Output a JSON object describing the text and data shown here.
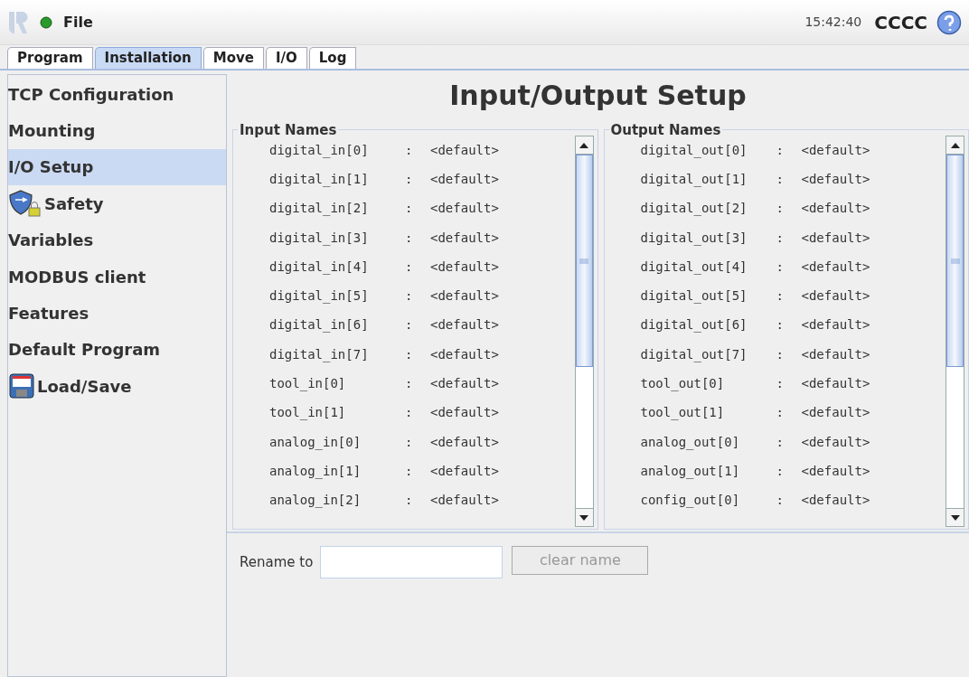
{
  "header": {
    "menu": "File",
    "time": "15:42:40",
    "robot_name": "CCCC"
  },
  "tabs": [
    {
      "label": "Program",
      "selected": false
    },
    {
      "label": "Installation",
      "selected": true
    },
    {
      "label": "Move",
      "selected": false
    },
    {
      "label": "I/O",
      "selected": false
    },
    {
      "label": "Log",
      "selected": false
    }
  ],
  "sidebar": {
    "items": [
      {
        "label": "TCP Configuration",
        "selected": false
      },
      {
        "label": "Mounting",
        "selected": false
      },
      {
        "label": "I/O Setup",
        "selected": true
      },
      {
        "label": "Safety",
        "selected": false,
        "kind": "safety"
      },
      {
        "label": "Variables",
        "selected": false
      },
      {
        "label": "MODBUS client",
        "selected": false
      },
      {
        "label": "Features",
        "selected": false
      },
      {
        "label": "Default Program",
        "selected": false
      },
      {
        "label": "Load/Save",
        "selected": false,
        "kind": "loadsave"
      }
    ]
  },
  "title": "Input/Output Setup",
  "groups": [
    {
      "title": "Input Names",
      "rows": [
        {
          "name": "digital_in[0]",
          "sep": ":",
          "value": "<default>"
        },
        {
          "name": "digital_in[1]",
          "sep": ":",
          "value": "<default>"
        },
        {
          "name": "digital_in[2]",
          "sep": ":",
          "value": "<default>"
        },
        {
          "name": "digital_in[3]",
          "sep": ":",
          "value": "<default>"
        },
        {
          "name": "digital_in[4]",
          "sep": ":",
          "value": "<default>"
        },
        {
          "name": "digital_in[5]",
          "sep": ":",
          "value": "<default>"
        },
        {
          "name": "digital_in[6]",
          "sep": ":",
          "value": "<default>"
        },
        {
          "name": "digital_in[7]",
          "sep": ":",
          "value": "<default>"
        },
        {
          "name": "tool_in[0]",
          "sep": ":",
          "value": "<default>"
        },
        {
          "name": "tool_in[1]",
          "sep": ":",
          "value": "<default>"
        },
        {
          "name": "analog_in[0]",
          "sep": ":",
          "value": "<default>"
        },
        {
          "name": "analog_in[1]",
          "sep": ":",
          "value": "<default>"
        },
        {
          "name": "analog_in[2]",
          "sep": ":",
          "value": "<default>"
        }
      ]
    },
    {
      "title": "Output Names",
      "rows": [
        {
          "name": "digital_out[0]",
          "sep": ":",
          "value": "<default>"
        },
        {
          "name": "digital_out[1]",
          "sep": ":",
          "value": "<default>"
        },
        {
          "name": "digital_out[2]",
          "sep": ":",
          "value": "<default>"
        },
        {
          "name": "digital_out[3]",
          "sep": ":",
          "value": "<default>"
        },
        {
          "name": "digital_out[4]",
          "sep": ":",
          "value": "<default>"
        },
        {
          "name": "digital_out[5]",
          "sep": ":",
          "value": "<default>"
        },
        {
          "name": "digital_out[6]",
          "sep": ":",
          "value": "<default>"
        },
        {
          "name": "digital_out[7]",
          "sep": ":",
          "value": "<default>"
        },
        {
          "name": "tool_out[0]",
          "sep": ":",
          "value": "<default>"
        },
        {
          "name": "tool_out[1]",
          "sep": ":",
          "value": "<default>"
        },
        {
          "name": "analog_out[0]",
          "sep": ":",
          "value": "<default>"
        },
        {
          "name": "analog_out[1]",
          "sep": ":",
          "value": "<default>"
        },
        {
          "name": "config_out[0]",
          "sep": ":",
          "value": "<default>"
        }
      ]
    }
  ],
  "rename": {
    "label": "Rename to",
    "button": "clear name",
    "button_disabled": true
  }
}
